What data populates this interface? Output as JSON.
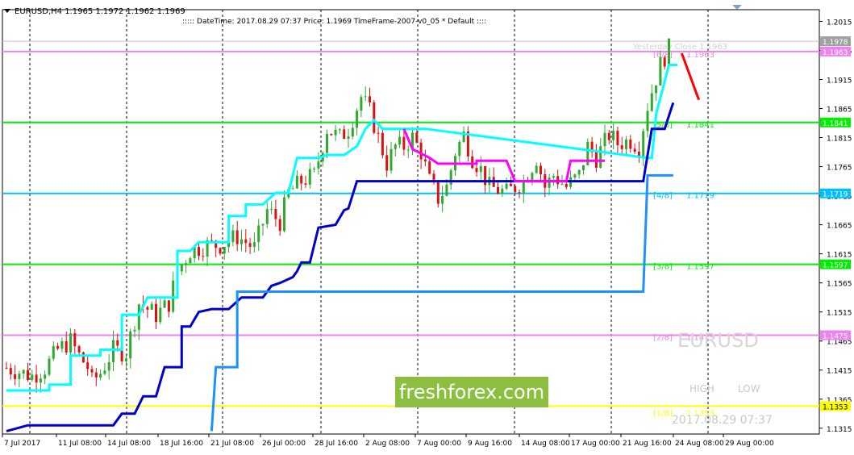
{
  "header": {
    "symbol_line": "EURUSD,H4  1.1965 1.1972 1.1962 1.1969",
    "info_line": "::::: DateTime: 2017.08.29 07:37    Price: 1.1969    TimeFrame-2007-v0_05    *    Default    ::::"
  },
  "watermark": "freshforex.com",
  "overlay": {
    "symbol": "EURUSD",
    "high_label": "HIGH",
    "low_label": "LOW",
    "datetime": "2017.08.29 07:37",
    "yesterday_close": "Yesterday Close 1.1963"
  },
  "colors": {
    "background": "#ffffff",
    "bull": "#2eab2e",
    "bear": "#dd1111",
    "cyan_line": "#00ffff",
    "navy_line": "#0000cc",
    "blue_line": "#1e90ff",
    "magenta_line": "#ff00ff",
    "pink_level": "#ee82ee",
    "green_level": "#00ee00",
    "blue_level": "#00bfff",
    "yellow_level": "#ffff00",
    "forecast": "#ff0000"
  },
  "chart_data": {
    "type": "candlestick",
    "symbol": "EURUSD",
    "timeframe": "H4",
    "ylim": [
      1.1305,
      1.2035
    ],
    "y_ticks": [
      "1.2015",
      "1.1965",
      "1.1915",
      "1.1865",
      "1.1815",
      "1.1765",
      "1.1715",
      "1.1665",
      "1.1615",
      "1.1565",
      "1.1515",
      "1.1465",
      "1.1415",
      "1.1365",
      "1.1315"
    ],
    "x_ticks": [
      "7 Jul 2017",
      "11 Jul 08:00",
      "14 Jul 08:00",
      "18 Jul 16:00",
      "21 Jul 08:00",
      "26 Jul 00:00",
      "28 Jul 16:00",
      "2 Aug 08:00",
      "7 Aug 00:00",
      "9 Aug 16:00",
      "14 Aug 08:00",
      "17 Aug 00:00",
      "21 Aug 16:00",
      "24 Aug 08:00",
      "29 Aug 00:00"
    ],
    "levels": [
      {
        "label": "[6/8]",
        "value_text": "1.1963",
        "badge": "1.1963",
        "value": 1.1963,
        "color": "#ee82ee"
      },
      {
        "label": "[5/8]",
        "value_text": "1.1841",
        "badge": "1.1841",
        "value": 1.1841,
        "color": "#00ee00"
      },
      {
        "label": "[4/8]",
        "value_text": "1.1719",
        "badge": "1.1719",
        "value": 1.1719,
        "color": "#00bfff"
      },
      {
        "label": "[3/8]",
        "value_text": "1.1597",
        "badge": "1.1597",
        "value": 1.1597,
        "color": "#00ee00"
      },
      {
        "label": "[2/8]",
        "value_text": "1.1475",
        "badge": "1.1475",
        "value": 1.1475,
        "color": "#ee82ee"
      },
      {
        "label": "[1/8]",
        "value_text": "1.1353",
        "badge": "1.1353",
        "value": 1.1353,
        "color": "#ffff00"
      }
    ],
    "current_price_badge": "1.1978",
    "current_price": 1.1978,
    "candle_count": 128,
    "close_path": [
      [
        0,
        1.1419
      ],
      [
        6,
        1.1405
      ],
      [
        9,
        1.1418
      ],
      [
        12,
        1.145
      ],
      [
        15,
        1.1465
      ],
      [
        17,
        1.144
      ],
      [
        19,
        1.142
      ],
      [
        20,
        1.1395
      ],
      [
        22,
        1.141
      ],
      [
        25,
        1.145
      ],
      [
        28,
        1.1445
      ],
      [
        31,
        1.153
      ],
      [
        35,
        1.151
      ],
      [
        38,
        1.153
      ],
      [
        40,
        1.1585
      ],
      [
        43,
        1.162
      ],
      [
        47,
        1.163
      ],
      [
        50,
        1.163
      ],
      [
        54,
        1.1645
      ],
      [
        58,
        1.1625
      ],
      [
        61,
        1.169
      ],
      [
        64,
        1.167
      ],
      [
        66,
        1.172
      ],
      [
        69,
        1.174
      ],
      [
        72,
        1.175
      ],
      [
        75,
        1.183
      ],
      [
        78,
        1.1815
      ],
      [
        80,
        1.183
      ],
      [
        83,
        1.1885
      ],
      [
        85,
        1.186
      ],
      [
        89,
        1.177
      ],
      [
        91,
        1.18
      ],
      [
        93,
        1.18
      ],
      [
        95,
        1.1815
      ],
      [
        97,
        1.179
      ],
      [
        99,
        1.174
      ],
      [
        101,
        1.171
      ],
      [
        103,
        1.173
      ],
      [
        105,
        1.179
      ],
      [
        107,
        1.182
      ],
      [
        109,
        1.178
      ],
      [
        111,
        1.176
      ],
      [
        113,
        1.173
      ],
      [
        117,
        1.172
      ],
      [
        121,
        1.174
      ],
      [
        124,
        1.178
      ],
      [
        126,
        1.173
      ],
      [
        128,
        1.175
      ],
      [
        131,
        1.173
      ],
      [
        134,
        1.175
      ],
      [
        136,
        1.18
      ],
      [
        138,
        1.178
      ],
      [
        141,
        1.182
      ],
      [
        143,
        1.1805
      ],
      [
        146,
        1.181
      ],
      [
        148,
        1.18
      ],
      [
        150,
        1.187
      ],
      [
        151,
        1.1895
      ],
      [
        153,
        1.194
      ],
      [
        155,
        1.1968
      ]
    ],
    "indicator_lines": [
      {
        "name": "cyan",
        "color": "#00ffff",
        "points": [
          [
            0,
            1.138
          ],
          [
            10,
            1.138
          ],
          [
            10,
            1.139
          ],
          [
            15,
            1.139
          ],
          [
            15,
            1.144
          ],
          [
            22,
            1.144
          ],
          [
            22,
            1.145
          ],
          [
            27,
            1.145
          ],
          [
            27,
            1.151
          ],
          [
            31,
            1.151
          ],
          [
            33,
            1.154
          ],
          [
            40,
            1.154
          ],
          [
            40,
            1.162
          ],
          [
            43,
            1.162
          ],
          [
            45,
            1.1635
          ],
          [
            52,
            1.1635
          ],
          [
            52,
            1.168
          ],
          [
            56,
            1.168
          ],
          [
            56,
            1.17
          ],
          [
            60,
            1.17
          ],
          [
            63,
            1.172
          ],
          [
            66,
            1.172
          ],
          [
            68,
            1.178
          ],
          [
            73,
            1.178
          ],
          [
            75,
            1.1785
          ],
          [
            79,
            1.1785
          ],
          [
            82,
            1.18
          ],
          [
            84,
            1.183
          ],
          [
            86,
            1.1845
          ],
          [
            88,
            1.183
          ],
          [
            89,
            1.183
          ],
          [
            98,
            1.183
          ],
          [
            150,
            1.178
          ],
          [
            151,
            1.178
          ],
          [
            152,
            1.1855
          ],
          [
            155,
            1.194
          ],
          [
            157,
            1.194
          ]
        ]
      },
      {
        "name": "navy",
        "color": "#0000cc",
        "points": [
          [
            0,
            1.131
          ],
          [
            5,
            1.132
          ],
          [
            25,
            1.132
          ],
          [
            27,
            1.134
          ],
          [
            30,
            1.134
          ],
          [
            32,
            1.137
          ],
          [
            35,
            1.137
          ],
          [
            37,
            1.142
          ],
          [
            41,
            1.142
          ],
          [
            41,
            1.149
          ],
          [
            43,
            1.149
          ],
          [
            45,
            1.1515
          ],
          [
            48,
            1.152
          ],
          [
            52,
            1.152
          ],
          [
            55,
            1.154
          ],
          [
            60,
            1.154
          ],
          [
            62,
            1.156
          ],
          [
            64,
            1.1565
          ],
          [
            67,
            1.1575
          ],
          [
            68,
            1.1585
          ],
          [
            69,
            1.16
          ],
          [
            71,
            1.16
          ],
          [
            73,
            1.166
          ],
          [
            77,
            1.1665
          ],
          [
            79,
            1.169
          ],
          [
            80,
            1.1693
          ],
          [
            82,
            1.174
          ],
          [
            149,
            1.174
          ],
          [
            151,
            1.183
          ],
          [
            154,
            1.183
          ],
          [
            156,
            1.1875
          ]
        ]
      },
      {
        "name": "blue",
        "color": "#1e90ff",
        "points": [
          [
            48,
            1.131
          ],
          [
            49,
            1.142
          ],
          [
            54,
            1.142
          ],
          [
            54,
            1.155
          ],
          [
            73,
            1.155
          ],
          [
            149,
            1.155
          ],
          [
            150,
            1.175
          ],
          [
            156,
            1.175
          ]
        ]
      },
      {
        "name": "magenta",
        "color": "#ff00ff",
        "points": [
          [
            93,
            1.183
          ],
          [
            95,
            1.1795
          ],
          [
            99,
            1.178
          ],
          [
            101,
            1.177
          ],
          [
            110,
            1.177
          ],
          [
            110,
            1.1775
          ],
          [
            117,
            1.1775
          ],
          [
            119,
            1.174
          ],
          [
            126,
            1.174
          ],
          [
            131,
            1.174
          ],
          [
            132,
            1.1775
          ],
          [
            140,
            1.1775
          ]
        ]
      }
    ],
    "forecast": {
      "color": "#ff0000",
      "from": [
        158,
        1.196
      ],
      "to": [
        162,
        1.188
      ]
    }
  }
}
